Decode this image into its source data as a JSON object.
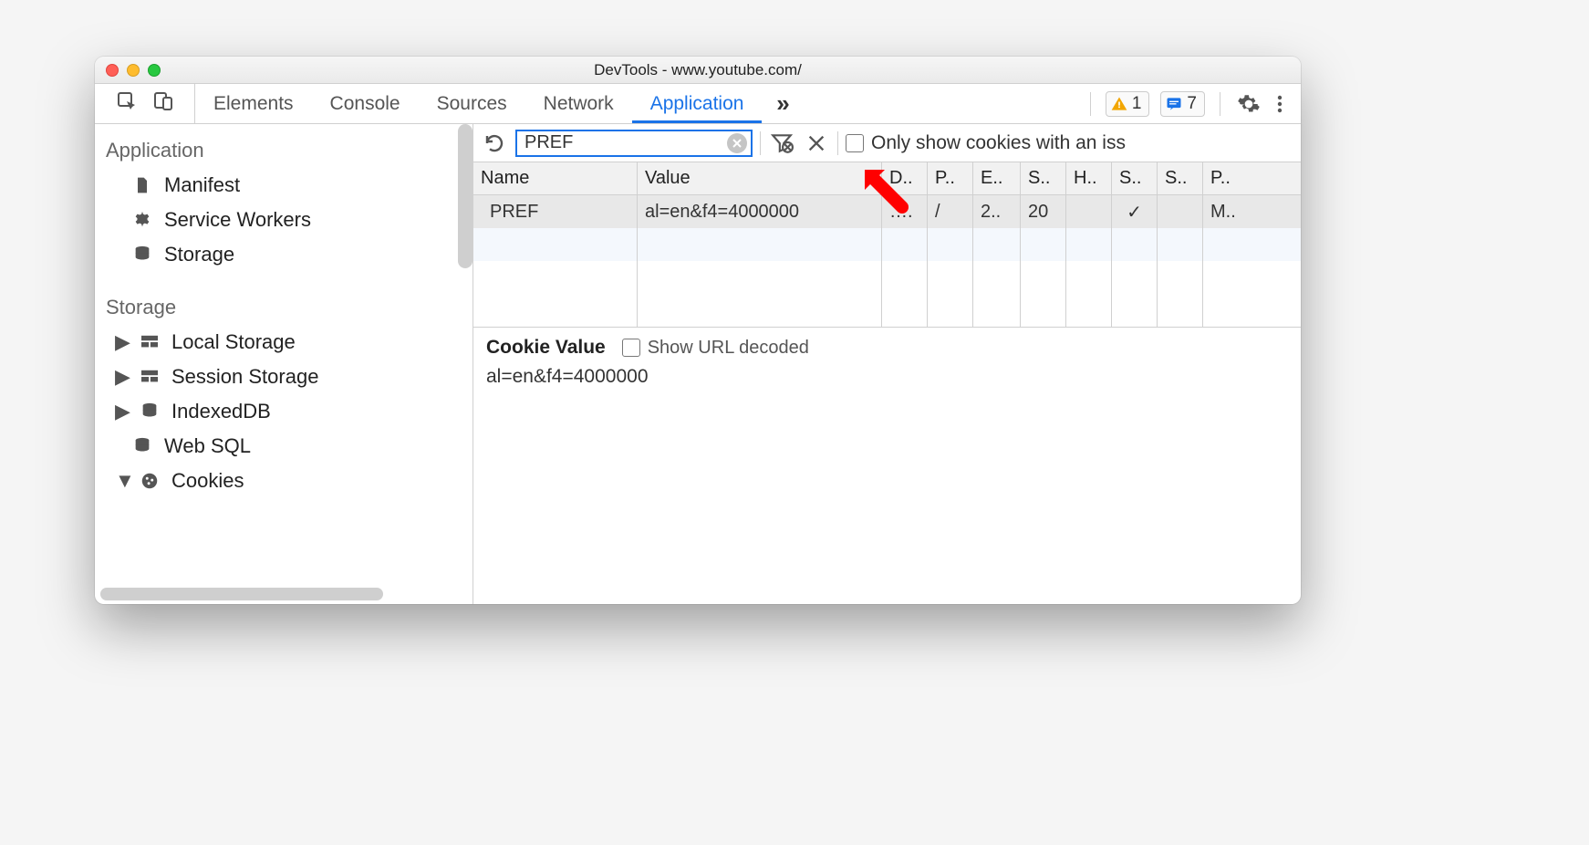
{
  "window": {
    "title": "DevTools - www.youtube.com/"
  },
  "tabs": {
    "items": [
      "Elements",
      "Console",
      "Sources",
      "Network",
      "Application"
    ],
    "active_index": 4,
    "more_glyph": "»"
  },
  "badges": {
    "warnings": "1",
    "messages": "7"
  },
  "sidebar": {
    "section_app": "Application",
    "app_items": [
      "Manifest",
      "Service Workers",
      "Storage"
    ],
    "section_storage": "Storage",
    "storage_items": [
      "Local Storage",
      "Session Storage",
      "IndexedDB",
      "Web SQL",
      "Cookies"
    ]
  },
  "toolbar": {
    "filter_value": "PREF",
    "only_issues_label": "Only show cookies with an iss"
  },
  "table": {
    "columns": [
      "Name",
      "Value",
      "D..",
      "P..",
      "E..",
      "S..",
      "H..",
      "S..",
      "S..",
      "P.."
    ],
    "rows": [
      {
        "name": "PREF",
        "value": "al=en&f4=4000000",
        "d": "….",
        "p": "/",
        "e": "2..",
        "s": "20",
        "h": "",
        "sec": "✓",
        "ss": "",
        "pr": "M.."
      }
    ]
  },
  "details": {
    "heading": "Cookie Value",
    "show_decoded_label": "Show URL decoded",
    "value": "al=en&f4=4000000"
  }
}
